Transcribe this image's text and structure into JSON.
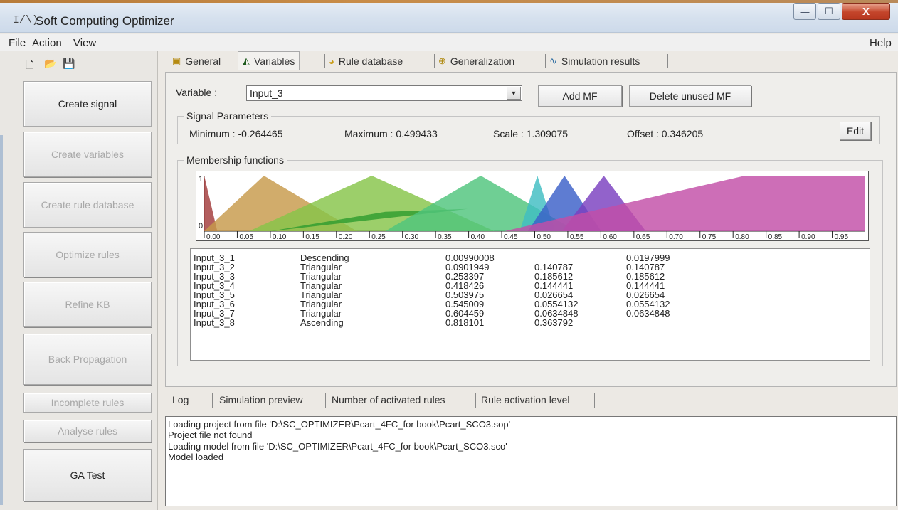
{
  "window": {
    "icon_glyph": "I/\\)",
    "title": "Soft Computing Optimizer",
    "controls": {
      "minimize": "—",
      "maximize": "☐",
      "close": "X"
    }
  },
  "menu": {
    "file": "File",
    "action": "Action",
    "view": "View",
    "help": "Help"
  },
  "toolbar": {
    "new_icon": "🗋",
    "open_icon": "📂",
    "save_icon": "💾"
  },
  "sidebar": {
    "buttons": [
      {
        "label": "Create signal",
        "enabled": true
      },
      {
        "label": "Create variables",
        "enabled": false
      },
      {
        "label": "Create rule database",
        "enabled": false
      },
      {
        "label": "Optimize rules",
        "enabled": false
      },
      {
        "label": "Refine KB",
        "enabled": false
      },
      {
        "label": "Back Propagation",
        "enabled": false
      },
      {
        "label": "Incomplete rules",
        "enabled": false
      },
      {
        "label": "Analyse rules",
        "enabled": false
      },
      {
        "label": "GA Test",
        "enabled": true
      }
    ]
  },
  "tabs": [
    {
      "label": "General",
      "icon": "general-icon"
    },
    {
      "label": "Variables",
      "icon": "variables-icon",
      "active": true
    },
    {
      "label": "Rule database",
      "icon": "rule-database-icon"
    },
    {
      "label": "Generalization",
      "icon": "generalization-icon"
    },
    {
      "label": "Simulation results",
      "icon": "simulation-results-icon"
    }
  ],
  "variable": {
    "label": "Variable :",
    "selected": "Input_3",
    "add_mf": "Add MF",
    "delete_unused_mf": "Delete unused MF"
  },
  "signal_parameters": {
    "title": "Signal Parameters",
    "minimum": "Minimum :  -0.264465",
    "maximum": "Maximum : 0.499433",
    "scale": "Scale :  1.309075",
    "offset": "Offset :  0.346205",
    "edit": "Edit"
  },
  "membership": {
    "title": "Membership functions",
    "y_top": "1",
    "y_bottom": "0",
    "x_ticks": [
      "0.00",
      "0.05",
      "0.10",
      "0.15",
      "0.20",
      "0.25",
      "0.30",
      "0.35",
      "0.40",
      "0.45",
      "0.50",
      "0.55",
      "0.60",
      "0.65",
      "0.70",
      "0.75",
      "0.80",
      "0.85",
      "0.90",
      "0.95"
    ],
    "colors": [
      "#a23a3a",
      "#c79a4a",
      "#86c549",
      "#2f9c2f",
      "#4fc47c",
      "#3fbdc2",
      "#3a5fc8",
      "#7a3fbf",
      "#c24ea7"
    ],
    "rows": [
      {
        "name": "Input_3_1",
        "type": "Descending",
        "v1": "0.00990008",
        "v2": "",
        "v3": "0.0197999"
      },
      {
        "name": "Input_3_2",
        "type": "Triangular",
        "v1": "0.0901949",
        "v2": "0.140787",
        "v3": "0.140787"
      },
      {
        "name": "Input_3_3",
        "type": "Triangular",
        "v1": "0.253397",
        "v2": "0.185612",
        "v3": "0.185612"
      },
      {
        "name": "Input_3_4",
        "type": "Triangular",
        "v1": "0.418426",
        "v2": "0.144441",
        "v3": "0.144441"
      },
      {
        "name": "Input_3_5",
        "type": "Triangular",
        "v1": "0.503975",
        "v2": "0.026654",
        "v3": "0.026654"
      },
      {
        "name": "Input_3_6",
        "type": "Triangular",
        "v1": "0.545009",
        "v2": "0.0554132",
        "v3": "0.0554132"
      },
      {
        "name": "Input_3_7",
        "type": "Triangular",
        "v1": "0.604459",
        "v2": "0.0634848",
        "v3": "0.0634848"
      },
      {
        "name": "Input_3_8",
        "type": "Ascending",
        "v1": "0.818101",
        "v2": "0.363792",
        "v3": ""
      }
    ]
  },
  "log_tabs": [
    "Log",
    "Simulation preview",
    "Number of activated rules",
    "Rule activation level"
  ],
  "log_lines": [
    "Loading project from file 'D:\\SC_OPTIMIZER\\Pcart_4FC_for book\\Pcart_SCO3.sop'",
    "Project file not found",
    "Loading model from file 'D:\\SC_OPTIMIZER\\Pcart_4FC_for book\\Pcart_SCO3.sco'",
    "Model loaded"
  ]
}
